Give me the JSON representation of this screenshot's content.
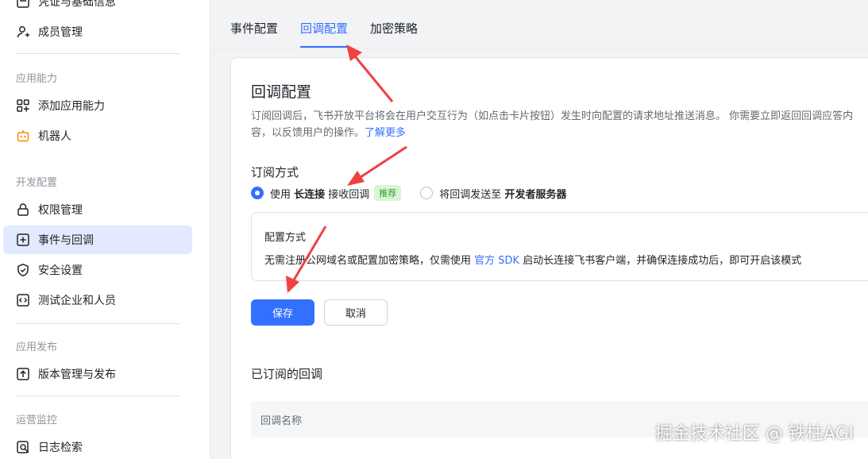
{
  "sidebar": {
    "items_top": [
      {
        "label": "凭证与基础信息",
        "icon": "list-icon"
      },
      {
        "label": "成员管理",
        "icon": "user-add-icon"
      }
    ],
    "sections": [
      {
        "label": "应用能力",
        "items": [
          {
            "label": "添加应用能力",
            "icon": "apps-add-icon"
          },
          {
            "label": "机器人",
            "icon": "robot-icon"
          }
        ]
      },
      {
        "label": "开发配置",
        "items": [
          {
            "label": "权限管理",
            "icon": "lock-icon"
          },
          {
            "label": "事件与回调",
            "icon": "event-icon",
            "active": true
          },
          {
            "label": "安全设置",
            "icon": "shield-icon"
          },
          {
            "label": "测试企业和人员",
            "icon": "code-icon"
          }
        ]
      },
      {
        "label": "应用发布",
        "items": [
          {
            "label": "版本管理与发布",
            "icon": "upload-icon"
          }
        ]
      },
      {
        "label": "运营监控",
        "items": [
          {
            "label": "日志检索",
            "icon": "log-search-icon"
          }
        ]
      }
    ]
  },
  "tabs": [
    {
      "label": "事件配置"
    },
    {
      "label": "回调配置",
      "active": true
    },
    {
      "label": "加密策略"
    }
  ],
  "main": {
    "title": "回调配置",
    "desc_line1": "订阅回调后，飞书开放平台将会在用户交互行为（如点击卡片按钮）发生时向配置的请求地址推送消息。 你需要立即返回回调应答内",
    "desc_line2": "容，以反馈用户的操作。",
    "desc_link": "了解更多",
    "subscribe_title": "订阅方式",
    "option1_pre": "使用 ",
    "option1_bold": "长连接",
    "option1_post": " 接收回调",
    "option1_tag": "推荐",
    "option2_pre": "将回调发送至 ",
    "option2_bold": "开发者服务器",
    "config_title": "配置方式",
    "config_text_pre": "无需注册公网域名或配置加密策略，仅需使用 ",
    "config_link": "官方 SDK",
    "config_text_post": " 启动长连接飞书客户端，并确保连接成功后，即可开启该模式",
    "save_label": "保存",
    "cancel_label": "取消",
    "subscribed_title": "已订阅的回调",
    "table_header": "回调名称"
  },
  "watermark": "掘金技术社区 @ 铁柱AGI",
  "colors": {
    "accent": "#3370ff",
    "arrow": "#f04142",
    "tag_bg": "#d9f5d6",
    "tag_text": "#2ea121"
  }
}
